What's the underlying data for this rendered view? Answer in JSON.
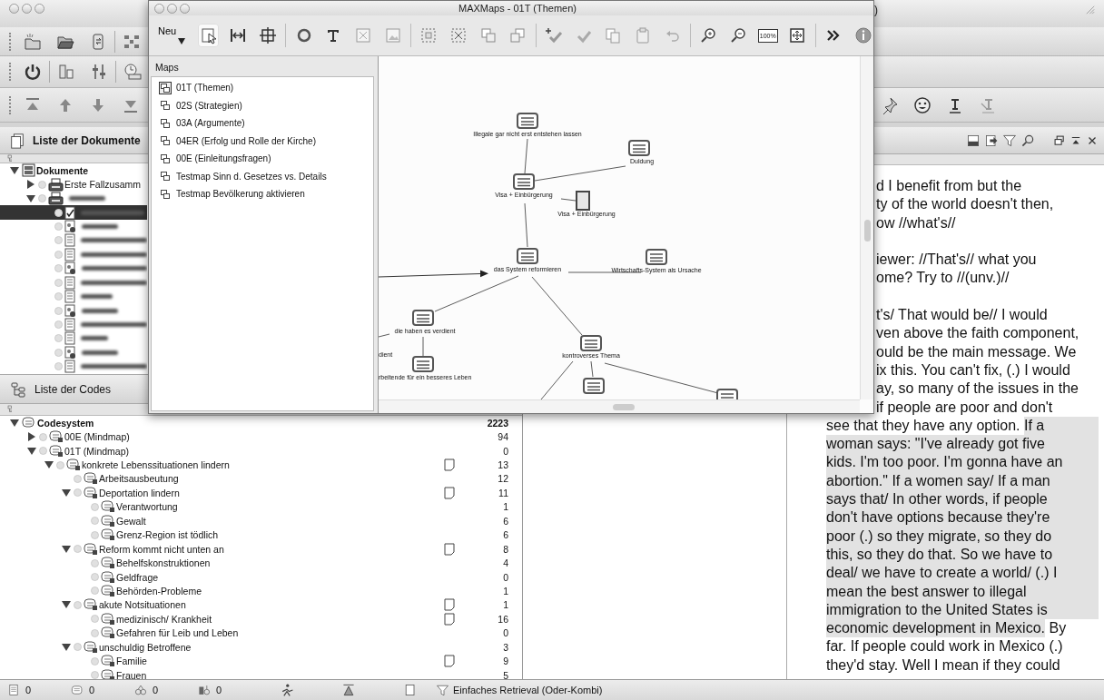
{
  "main_window": {
    "title_fragment": ")"
  },
  "maps_window": {
    "title": "MAXMaps - 01T (Themen)",
    "new_button": "Neu",
    "tools": [
      {
        "selected": true
      },
      {
        "selected": false
      },
      {
        "selected": false
      },
      {
        "selected": false
      },
      {
        "selected": false
      },
      {
        "selected": false
      },
      {
        "selected": false
      },
      {
        "selected": false
      },
      {
        "selected": false
      },
      {
        "selected": false
      },
      {
        "selected": false
      },
      {
        "selected": false
      },
      {
        "selected": false
      },
      {
        "selected": false
      },
      {
        "selected": false
      },
      {
        "selected": false
      },
      {
        "selected": false
      },
      {
        "selected": false
      },
      {
        "selected": false,
        "label": "100%"
      },
      {
        "selected": false
      },
      {
        "selected": false
      },
      {
        "selected": false
      }
    ],
    "list_title": "Maps",
    "maps": [
      {
        "label": "01T (Themen)",
        "selected": true
      },
      {
        "label": "02S (Strategien)",
        "selected": false
      },
      {
        "label": "03A (Argumente)",
        "selected": false
      },
      {
        "label": "04ER (Erfolg und Rolle der Kirche)",
        "selected": false
      },
      {
        "label": "00E (Einleitungsfragen)",
        "selected": false
      },
      {
        "label": "Testmap Sinn d. Gesetzes vs. Details",
        "selected": false
      },
      {
        "label": "Testmap Bevölkerung aktivieren",
        "selected": false
      }
    ],
    "nodes": [
      {
        "kind": "code",
        "label": "Illegale gar nicht erst entstehen lassen"
      },
      {
        "kind": "code",
        "label": "Duldung"
      },
      {
        "kind": "code",
        "label": "Visa + Einbürgerung"
      },
      {
        "kind": "document",
        "label": "Visa + Einbürgerung"
      },
      {
        "kind": "code",
        "label": "das System reformieren"
      },
      {
        "kind": "code",
        "label": "Wirtschafts-System als Ursache"
      },
      {
        "kind": "code",
        "label": "die haben es verdient"
      },
      {
        "kind": "label",
        "label": "dient"
      },
      {
        "kind": "code",
        "label": "rbeitende für ein besseres Leben"
      },
      {
        "kind": "code",
        "label": "kontroverses Thema"
      },
      {
        "kind": "code"
      },
      {
        "kind": "code"
      }
    ]
  },
  "documents_panel": {
    "title": "Liste der Dokumente",
    "tree": [
      {
        "label": "Dokumente",
        "kind": "root",
        "expanded": true,
        "children": [
          {
            "label": "Erste Fallzusamm",
            "kind": "group",
            "expanded": false
          },
          {
            "kind": "group",
            "expanded": true,
            "children": [
              {
                "kind": "text",
                "selected": true
              },
              {
                "kind": "image",
                "selected": false
              },
              {
                "kind": "text",
                "selected": false
              },
              {
                "kind": "text",
                "selected": false
              },
              {
                "kind": "image",
                "selected": false
              },
              {
                "kind": "text",
                "selected": false
              },
              {
                "kind": "text",
                "selected": false
              },
              {
                "kind": "image",
                "selected": false
              },
              {
                "kind": "text",
                "selected": false
              },
              {
                "kind": "text",
                "selected": false
              },
              {
                "kind": "image",
                "selected": false
              },
              {
                "kind": "text",
                "selected": false
              }
            ]
          }
        ]
      }
    ]
  },
  "codes_panel": {
    "title": "Liste der Codes",
    "tree": [
      {
        "label": "Codesystem",
        "count": "2223",
        "root": true,
        "expanded": true,
        "children": [
          {
            "label": "00E (Mindmap)",
            "count": "94",
            "expanded": false
          },
          {
            "label": "01T (Mindmap)",
            "count": "0",
            "expanded": true,
            "children": [
              {
                "label": "konkrete Lebenssituationen lindern",
                "count": "13",
                "memo": true,
                "expanded": true,
                "children": [
                  {
                    "label": "Arbeitsausbeutung",
                    "count": "12"
                  },
                  {
                    "label": "Deportation lindern",
                    "count": "11",
                    "memo": true,
                    "expanded": true,
                    "children": [
                      {
                        "label": "Verantwortung",
                        "count": "1"
                      },
                      {
                        "label": "Gewalt",
                        "count": "6"
                      },
                      {
                        "label": "Grenz-Region ist tödlich",
                        "count": "6"
                      }
                    ]
                  },
                  {
                    "label": "Reform kommt nicht unten an",
                    "count": "8",
                    "memo": true,
                    "expanded": true,
                    "children": [
                      {
                        "label": "Behelfskonstruktionen",
                        "count": "4"
                      },
                      {
                        "label": "Geldfrage",
                        "count": "0"
                      },
                      {
                        "label": "Behörden-Probleme",
                        "count": "1"
                      }
                    ]
                  },
                  {
                    "label": "akute Notsituationen",
                    "count": "1",
                    "memo": true,
                    "expanded": true,
                    "children": [
                      {
                        "label": "medizinisch/ Krankheit",
                        "count": "16",
                        "memo": true
                      },
                      {
                        "label": "Gefahren für Leib und Leben",
                        "count": "0"
                      }
                    ]
                  },
                  {
                    "label": "unschuldig Betroffene",
                    "count": "3",
                    "expanded": true,
                    "children": [
                      {
                        "label": "Familie",
                        "count": "9",
                        "memo": true
                      },
                      {
                        "label": "Frauen",
                        "count": "5"
                      }
                    ]
                  }
                ]
              }
            ]
          }
        ]
      }
    ]
  },
  "transcript": {
    "covered_paragraphs": [
      [
        "d I benefit from but the",
        "ty of the world doesn't then,",
        "ow //what's//"
      ],
      [
        "iewer: //That's// what you",
        "ome? Try to //(unv.)//"
      ],
      [
        "t's/ That would be// I would",
        "ven above the faith component,",
        "ould be the main message. We",
        "ix this. You can't fix, (.) I would",
        "ay, so many of the issues in the",
        "if people are poor and don't"
      ]
    ],
    "lines": [
      {
        "segments": [
          {
            "text": "see that they have any option. ",
            "highlighted": false
          },
          {
            "text": "If a",
            "highlighted": true
          }
        ]
      },
      {
        "segments": [
          {
            "text": "woman says: \"I've already got five",
            "highlighted": true
          }
        ]
      },
      {
        "segments": [
          {
            "text": "kids. I'm too poor. I'm gonna have an",
            "highlighted": true
          }
        ]
      },
      {
        "segments": [
          {
            "text": "abortion.\" If a women say/ If a man",
            "highlighted": true
          }
        ]
      },
      {
        "segments": [
          {
            "text": "says that/ In other words, if people",
            "highlighted": true
          }
        ]
      },
      {
        "segments": [
          {
            "text": "don't have options because they're",
            "highlighted": true
          }
        ]
      },
      {
        "segments": [
          {
            "text": "poor (.) so they migrate, so they do",
            "highlighted": true
          }
        ]
      },
      {
        "segments": [
          {
            "text": "this, so they do that. So we have to",
            "highlighted": true
          }
        ]
      },
      {
        "segments": [
          {
            "text": "deal/ we have to create a world/ (.) I",
            "highlighted": true
          }
        ]
      },
      {
        "segments": [
          {
            "text": "mean the best answer to illegal",
            "highlighted": true
          }
        ]
      },
      {
        "segments": [
          {
            "text": "immigration to the United States is",
            "highlighted": true
          }
        ]
      },
      {
        "segments": [
          {
            "text": "economic development in Mexico.",
            "highlighted": true
          },
          {
            "text": " By",
            "highlighted": false
          }
        ]
      },
      {
        "segments": [
          {
            "text": "far. If people could work in Mexico (.)",
            "highlighted": false
          }
        ]
      },
      {
        "segments": [
          {
            "text": "they'd stay. Well I mean if they could",
            "highlighted": false
          }
        ]
      }
    ]
  },
  "status_bar": {
    "counts": [
      "0",
      "0",
      "0",
      "0"
    ],
    "retrieval": "Einfaches Retrieval (Oder-Kombi)"
  }
}
